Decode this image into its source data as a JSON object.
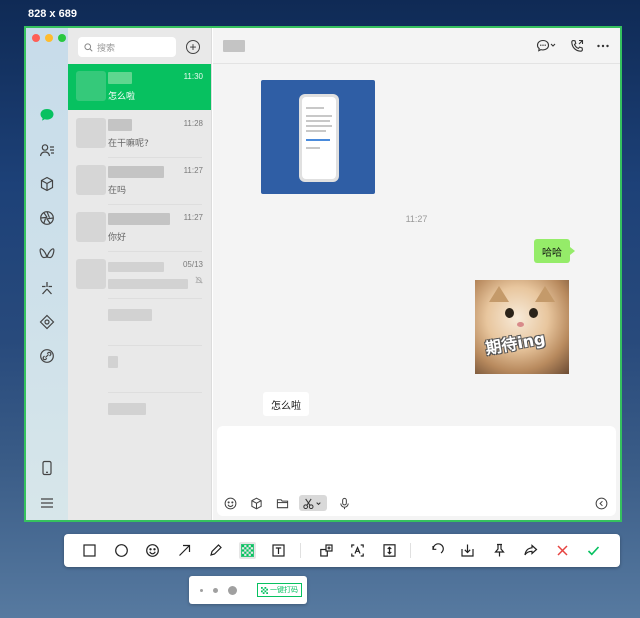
{
  "screen_size_label": "828 x 689",
  "search": {
    "placeholder": "搜索"
  },
  "chat_list": [
    {
      "time": "11:30",
      "preview": "怎么啦"
    },
    {
      "time": "11:28",
      "preview": "在干嘛呢?"
    },
    {
      "time": "11:27",
      "preview": "在吗"
    },
    {
      "time": "11:27",
      "preview": "你好"
    },
    {
      "time": "05/13",
      "preview": ""
    }
  ],
  "conversation": {
    "time_divider": "11:27",
    "outgoing_text": "哈哈",
    "sticker_text": "期待ing",
    "incoming_text": "怎么啦"
  },
  "annotation_subtoolbar": {
    "mosaic_label": "一键打码"
  },
  "colors": {
    "accent": "#07c160",
    "outgoing_bubble": "#95ec69",
    "selection_border": "#35c15e",
    "cancel": "#e64340"
  }
}
